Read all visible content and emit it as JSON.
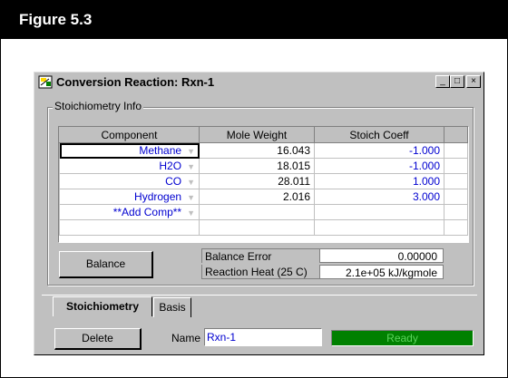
{
  "figure": {
    "title": "Figure 5.3"
  },
  "window": {
    "title": "Conversion Reaction: Rxn-1",
    "controls": {
      "minimize": "_",
      "restore": "□",
      "close": "×"
    }
  },
  "stoich": {
    "group_label": "Stoichiometry Info",
    "columns": [
      "Component",
      "Mole Weight",
      "Stoich Coeff"
    ],
    "rows": [
      {
        "component": "Methane",
        "mole_weight": "16.043",
        "stoich_coeff": "-1.000"
      },
      {
        "component": "H2O",
        "mole_weight": "18.015",
        "stoich_coeff": "-1.000"
      },
      {
        "component": "CO",
        "mole_weight": "28.011",
        "stoich_coeff": "1.000"
      },
      {
        "component": "Hydrogen",
        "mole_weight": "2.016",
        "stoich_coeff": "3.000"
      },
      {
        "component": "**Add Comp**",
        "mole_weight": "",
        "stoich_coeff": ""
      }
    ]
  },
  "balance_button": "Balance",
  "results": {
    "balance_error_label": "Balance Error",
    "balance_error_value": "0.00000",
    "reaction_heat_label": "Reaction Heat (25 C)",
    "reaction_heat_value": "2.1e+05 kJ/kgmole"
  },
  "tabs": [
    {
      "label": "Stoichiometry",
      "active": true
    },
    {
      "label": "Basis",
      "active": false
    }
  ],
  "footer": {
    "delete_label": "Delete",
    "name_label": "Name",
    "name_value": "Rxn-1",
    "status_text": "Ready"
  },
  "colors": {
    "status_bg": "#008000",
    "value_blue": "#0000d0",
    "window_gray": "#c0c0c0"
  }
}
